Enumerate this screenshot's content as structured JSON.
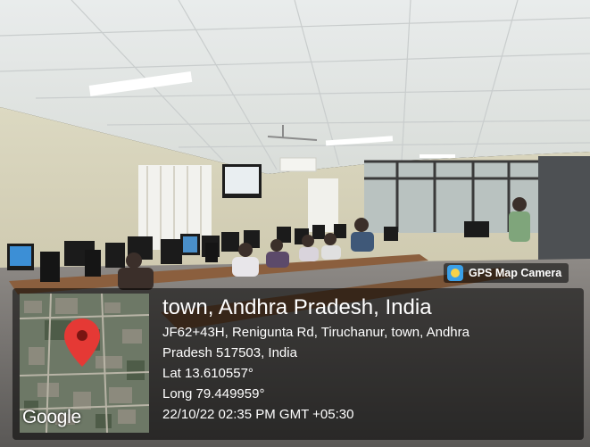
{
  "camera_badge": {
    "label": "GPS Map Camera",
    "icon": "gps-map-camera-icon"
  },
  "location": {
    "title": "town, Andhra Pradesh, India",
    "address_line_1": "JF62+43H, Renigunta Rd, Tiruchanur, town, Andhra",
    "address_line_2": "Pradesh 517503, India",
    "latitude": "Lat 13.610557°",
    "longitude": "Long 79.449959°",
    "datetime": "22/10/22 02:35 PM GMT +05:30"
  },
  "map": {
    "provider": "Google",
    "pin_color": "#e53935"
  }
}
